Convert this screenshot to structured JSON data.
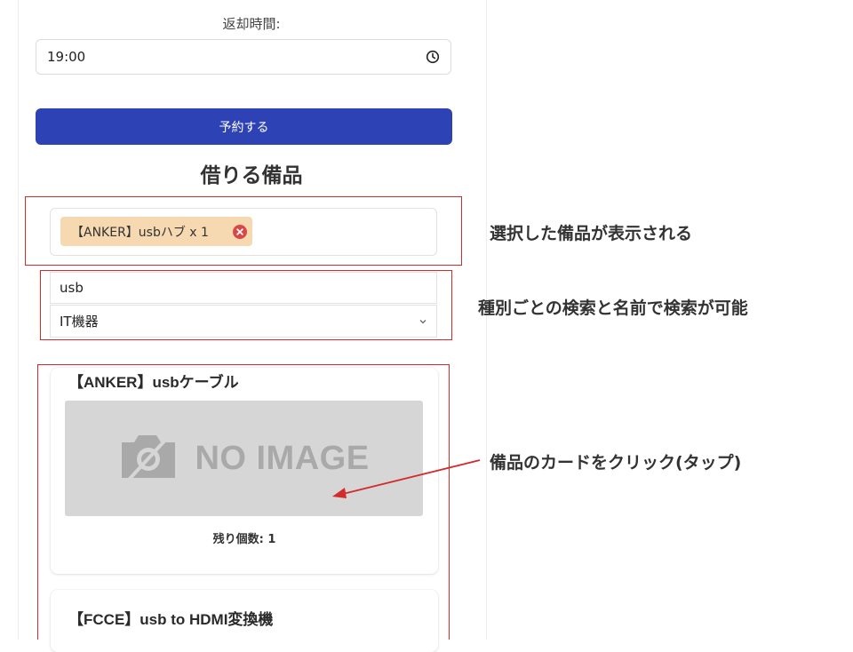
{
  "form": {
    "return_time_label": "返却時間:",
    "return_time_value": "19:00",
    "reserve_button": "予約する"
  },
  "section": {
    "title": "借りる備品"
  },
  "selected": {
    "items": [
      {
        "label": "【ANKER】usbハブ x 1"
      }
    ]
  },
  "search": {
    "query": "usb",
    "category": "IT機器"
  },
  "cards": [
    {
      "title": "【ANKER】usbケーブル",
      "image_text": "NO IMAGE",
      "stock": "残り個数: 1"
    },
    {
      "title": "【FCCE】usb to HDMI変換機"
    }
  ],
  "annotations": {
    "selected_note": "選択した備品が表示される",
    "search_note": "種別ごとの検索と名前で検索が可能",
    "card_note": "備品のカードをクリック(タップ)"
  },
  "colors": {
    "primary": "#2d42b5",
    "chip_bg": "#f6d8b1",
    "chip_remove": "#d94848",
    "annotation_red": "#d32a2a",
    "placeholder_bg": "#d6d6d6"
  },
  "icons": {
    "time": "clock-icon",
    "remove": "close-circle-icon",
    "select": "chevron-down-icon",
    "image": "camera-off-icon"
  }
}
